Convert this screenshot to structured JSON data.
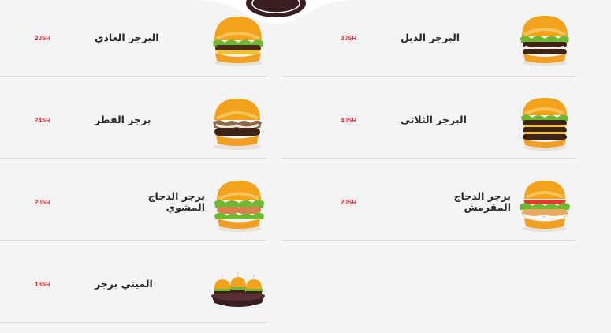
{
  "colors": {
    "background": "#f4f4f4",
    "price": "#e0282e",
    "text": "#2a2a2a",
    "divider": "#dcdcdc",
    "logo": "#3a1f22"
  },
  "menu": {
    "items": [
      {
        "name": "البرجر العادي",
        "price": "20SR",
        "image_icon": "burger-classic-icon"
      },
      {
        "name": "البرجر الدبل",
        "price": "30SR",
        "image_icon": "burger-double-icon"
      },
      {
        "name": "برجر الفطر",
        "price": "24SR",
        "image_icon": "burger-mushroom-icon"
      },
      {
        "name": "البرجر الثلاثي",
        "price": "40SR",
        "image_icon": "burger-triple-icon"
      },
      {
        "name": "برجر الدجاج المشوي",
        "price": "20SR",
        "image_icon": "burger-grilled-chicken-icon"
      },
      {
        "name": "برجر الدجاج المقرمش",
        "price": "20SR",
        "image_icon": "burger-crispy-chicken-icon"
      },
      {
        "name": "الميني برجر",
        "price": "18SR",
        "image_icon": "mini-burgers-icon"
      }
    ]
  }
}
